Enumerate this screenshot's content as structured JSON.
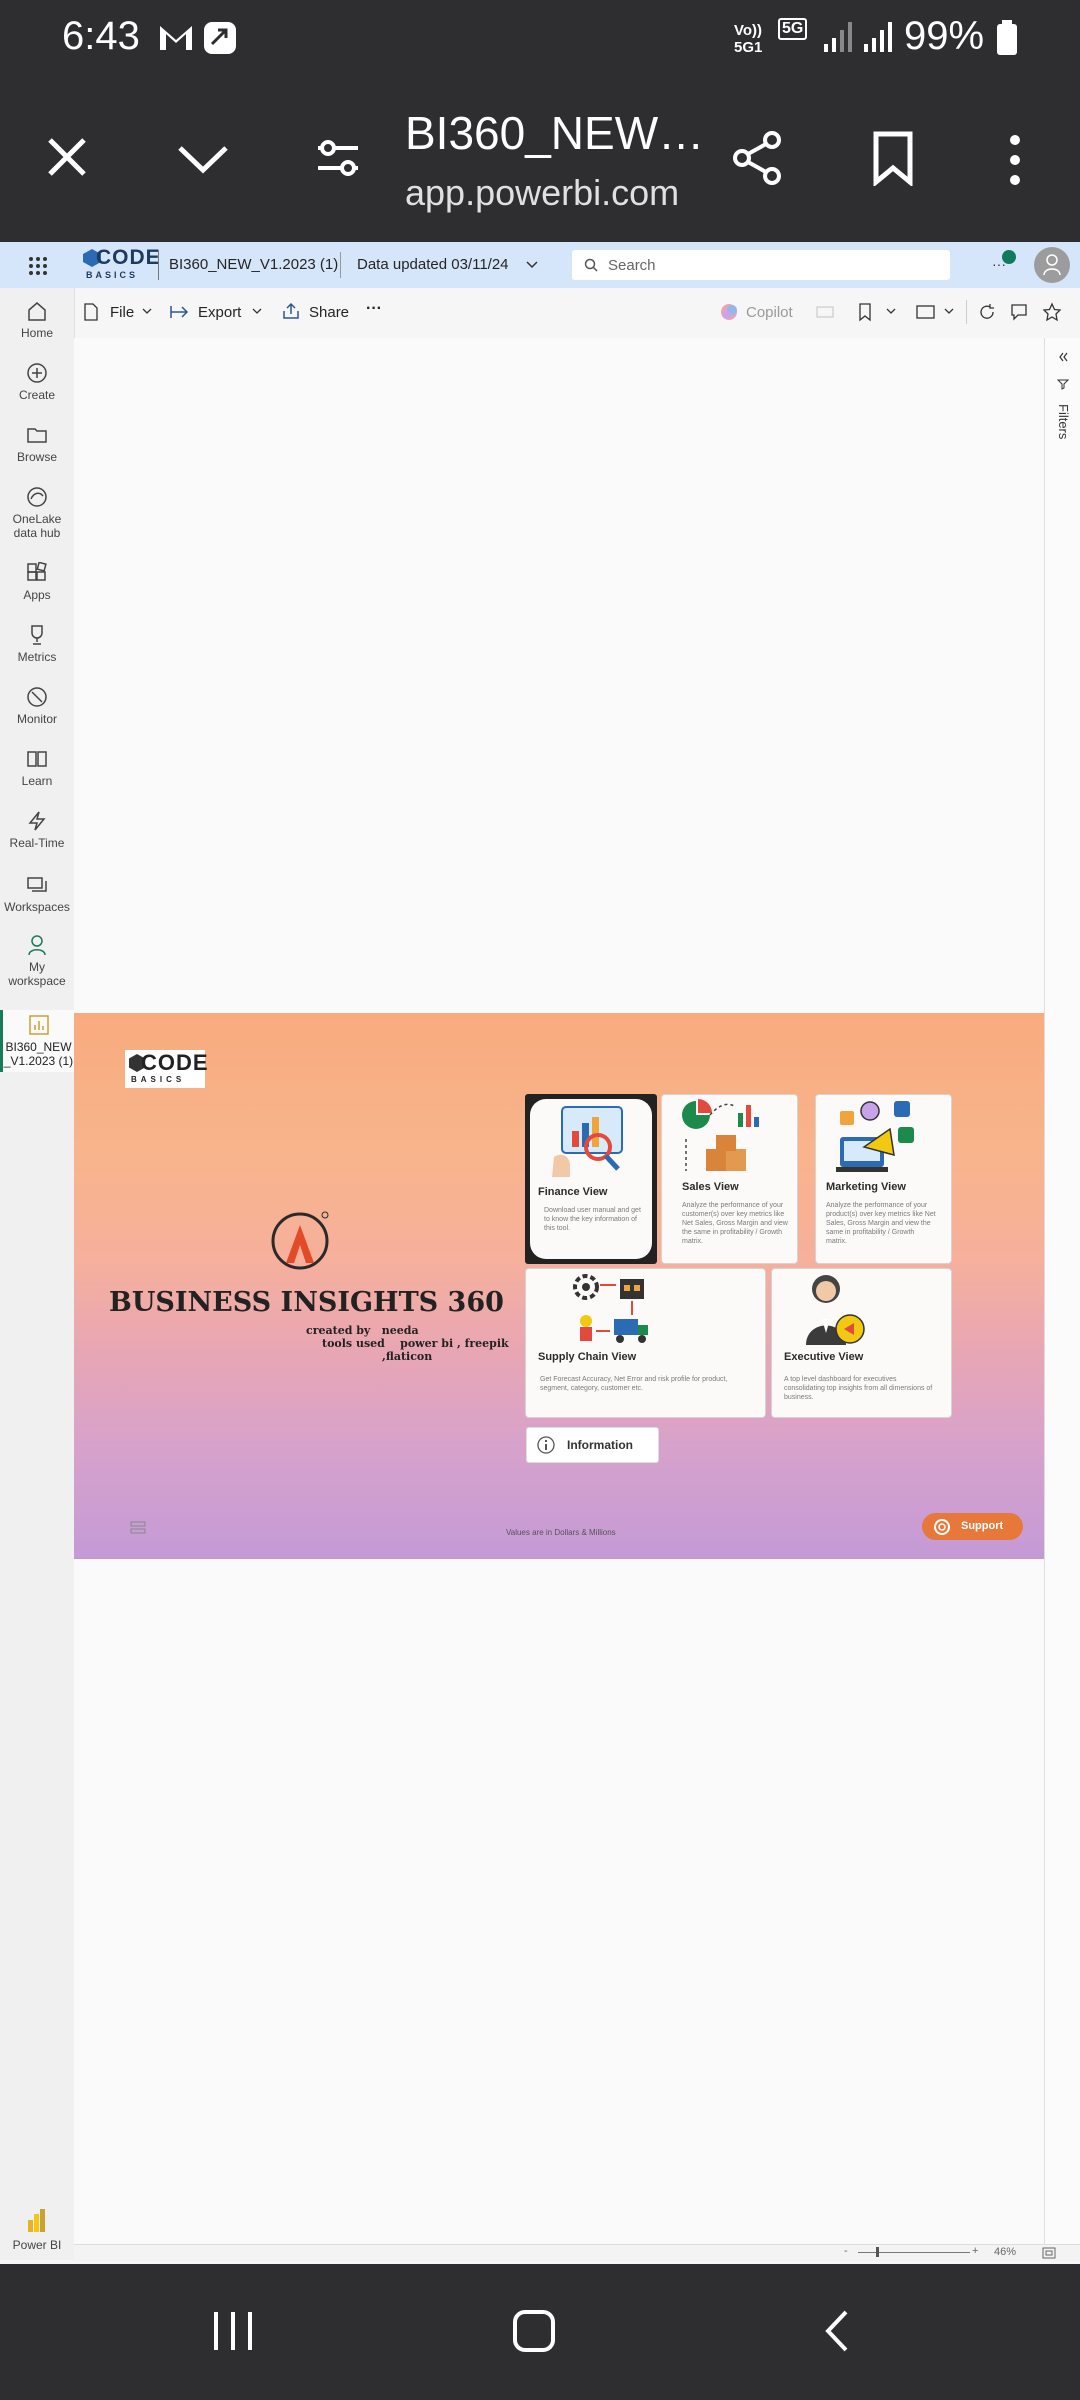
{
  "status": {
    "time": "6:43",
    "network": "5G",
    "volte": "Vo)) 5G1",
    "battery": "99%"
  },
  "browser": {
    "title": "BI360_NEW…",
    "url": "app.powerbi.com"
  },
  "pbi": {
    "logo_top": "CODE",
    "logo_bottom": "BASICS",
    "report_name": "BI360_NEW_V1.2023 (1)",
    "data_updated": "Data updated 03/11/24",
    "search_placeholder": "Search",
    "toolbar": {
      "file": "File",
      "export": "Export",
      "share": "Share",
      "more": "···",
      "copilot": "Copilot"
    },
    "filters_label": "Filters",
    "zoom": "46%"
  },
  "leftnav": [
    {
      "label": "Home",
      "icon": "home-icon"
    },
    {
      "label": "Create",
      "icon": "plus-circle-icon"
    },
    {
      "label": "Browse",
      "icon": "folder-icon"
    },
    {
      "label": "OneLake data hub",
      "icon": "onelake-icon"
    },
    {
      "label": "Apps",
      "icon": "apps-icon"
    },
    {
      "label": "Metrics",
      "icon": "trophy-icon"
    },
    {
      "label": "Monitor",
      "icon": "monitor-icon"
    },
    {
      "label": "Learn",
      "icon": "book-icon"
    },
    {
      "label": "Real-Time",
      "icon": "lightning-icon"
    },
    {
      "label": "Workspaces",
      "icon": "workspaces-icon"
    },
    {
      "label": "My workspace",
      "icon": "person-icon"
    },
    {
      "label": "BI360_NEW _V1.2023 (1)",
      "icon": "report-icon"
    }
  ],
  "leftnav_footer": "Power BI",
  "report": {
    "logo_top": "CODE",
    "logo_bottom": "BASICS",
    "title": "BUSINESS INSIGHTS 360",
    "created_by": "created by   needa",
    "tools_used": "tools used    power bi , freepik",
    "tools_used_2": ",flaticon",
    "values_note": "Values are in Dollars & Millions",
    "support": "Support",
    "information": "Information",
    "cards": [
      {
        "title": "Finance View",
        "desc": "Download user manual and get to know the key information of this tool."
      },
      {
        "title": "Sales View",
        "desc": "Analyze the performance of your customer(s) over key metrics like Net Sales, Gross Margin and view the same in profitability / Growth matrix."
      },
      {
        "title": "Marketing View",
        "desc": "Analyze the performance of your product(s) over key metrics like Net Sales, Gross Margin and view the same in profitability / Growth matrix."
      },
      {
        "title": "Supply Chain View",
        "desc": "Get Forecast Accuracy, Net Error and risk profile for product, segment, category, customer etc."
      },
      {
        "title": "Executive View",
        "desc": "A top level dashboard for executives consolidating top insights from all dimensions of business."
      }
    ]
  }
}
